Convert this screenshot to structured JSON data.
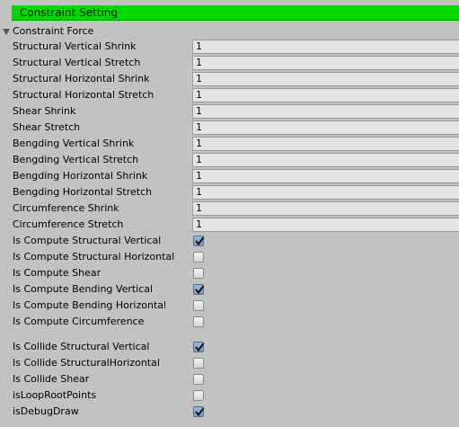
{
  "header": {
    "title": "Constraint Setting",
    "color": "#00d800"
  },
  "foldout": {
    "label": "Constraint Force",
    "expanded": true
  },
  "fields": [
    {
      "label": "Structural Vertical Shrink",
      "value": "1"
    },
    {
      "label": "Structural Vertical Stretch",
      "value": "1"
    },
    {
      "label": "Structural Horizontal Shrink",
      "value": "1"
    },
    {
      "label": "Structural Horizontal Stretch",
      "value": "1"
    },
    {
      "label": "Shear Shrink",
      "value": "1"
    },
    {
      "label": "Shear Stretch",
      "value": "1"
    },
    {
      "label": "Bengding Vertical Shrink",
      "value": "1"
    },
    {
      "label": "Bengding Vertical Stretch",
      "value": "1"
    },
    {
      "label": "Bengding Horizontal Shrink",
      "value": "1"
    },
    {
      "label": "Bengding Horizontal Stretch",
      "value": "1"
    },
    {
      "label": "Circumference Shrink",
      "value": "1"
    },
    {
      "label": "Circumference Stretch",
      "value": "1"
    }
  ],
  "compute_toggles": [
    {
      "label": "Is Compute Structural Vertical",
      "checked": true
    },
    {
      "label": "Is Compute Structural Horizontal",
      "checked": false
    },
    {
      "label": "Is Compute Shear",
      "checked": false
    },
    {
      "label": "Is Compute Bending Vertical",
      "checked": true
    },
    {
      "label": "Is Compute Bending Horizontal",
      "checked": false
    },
    {
      "label": "Is Compute Circumference",
      "checked": false
    }
  ],
  "collide_toggles": [
    {
      "label": "Is Collide Structural Vertical",
      "checked": true
    },
    {
      "label": "Is Collide StructuralHorizontal",
      "checked": false
    },
    {
      "label": "Is Collide Shear",
      "checked": false
    },
    {
      "label": "isLoopRootPoints",
      "checked": false
    },
    {
      "label": "isDebugDraw",
      "checked": true
    }
  ]
}
